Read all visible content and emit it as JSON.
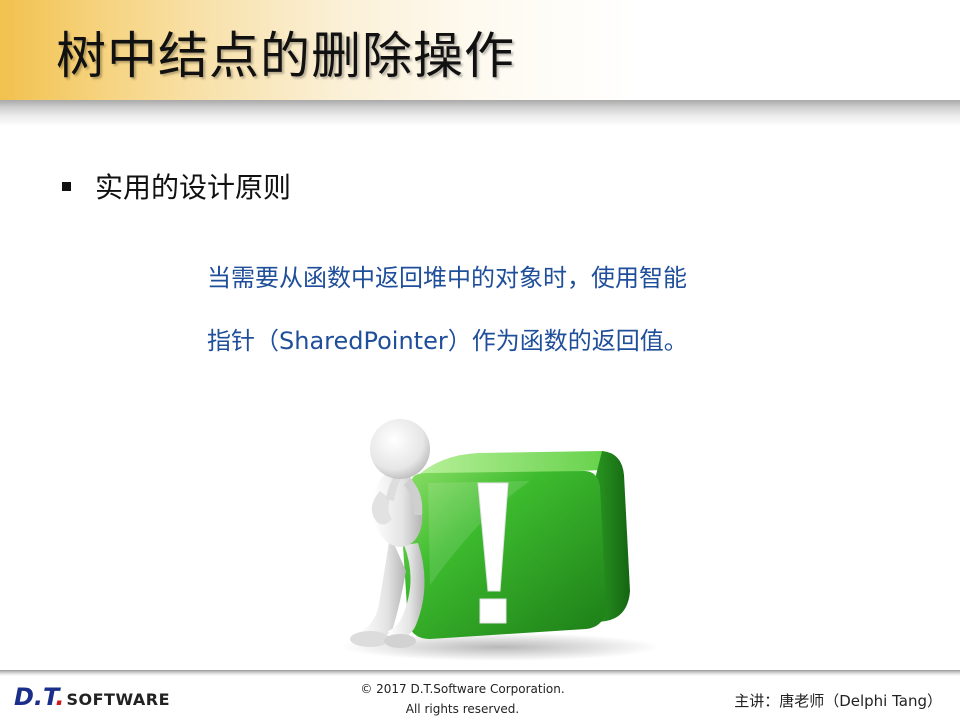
{
  "slide": {
    "title": "树中结点的删除操作"
  },
  "content": {
    "bullet": "实用的设计原则",
    "principle_line1": "当需要从函数中返回堆中的对象时，使用智能",
    "principle_line2": "指针（SharedPointer）作为函数的返回值。"
  },
  "illustration": {
    "icon_name": "exclamation-cube-with-thinking-figure",
    "cube_color": "#35b52f",
    "mark": "!"
  },
  "footer": {
    "logo_dt": "D.",
    "logo_t": "T",
    "logo_dot": ".",
    "logo_software": "SOFTWARE",
    "copyright_line1": "© 2017 D.T.Software Corporation.",
    "copyright_line2": "All rights reserved.",
    "presenter": "主讲：唐老师（Delphi Tang）"
  },
  "colors": {
    "title_band": "#f2c14e",
    "principle_text": "#1f4e9a",
    "logo_blue": "#1b2f8a",
    "logo_red": "#d01818"
  }
}
